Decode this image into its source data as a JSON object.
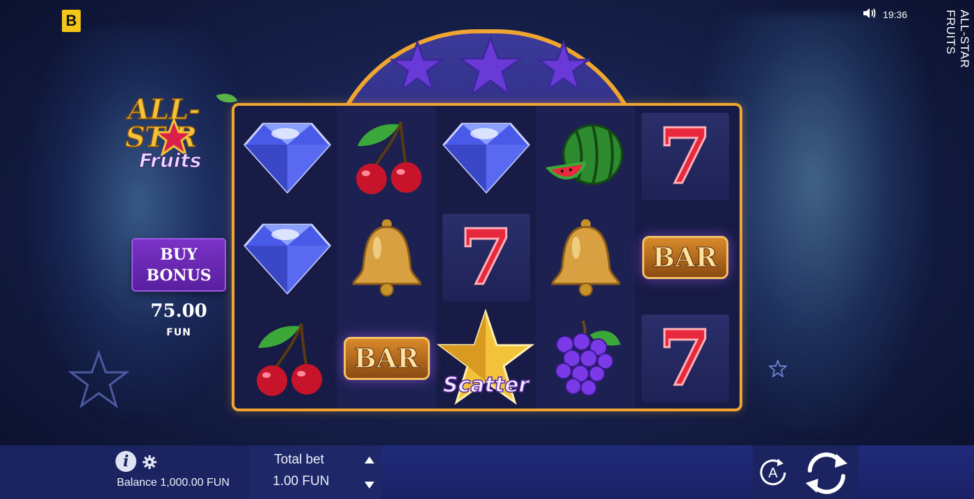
{
  "app": {
    "brand_logo_letter": "B",
    "time": "19:36",
    "side_title": "ALL-STAR FRUITS"
  },
  "game_logo": {
    "line1": "ALL-",
    "line2": "ST  R",
    "line3": "Fruits"
  },
  "buy_bonus": {
    "label_line1": "BUY",
    "label_line2": "BONUS",
    "price": "75.00",
    "currency": "FUN"
  },
  "reels": [
    [
      "diamond",
      "diamond",
      "cherry"
    ],
    [
      "cherry",
      "bell",
      "bar"
    ],
    [
      "diamond",
      "seven",
      "scatter"
    ],
    [
      "watermelon",
      "bell",
      "grapes"
    ],
    [
      "seven",
      "bar",
      "seven"
    ]
  ],
  "symbols": {
    "seven_text": "7",
    "bar_text": "BAR",
    "scatter_text": "Scatter"
  },
  "bottom_bar": {
    "balance": "Balance 1,000.00 FUN",
    "total_bet_label": "Total bet",
    "total_bet_value": "1.00 FUN",
    "info_glyph": "i",
    "auto_glyph": "A"
  },
  "colors": {
    "frame_gold": "#f0a530",
    "bonus_purple": "#7a32c6",
    "brand_yellow": "#f5c518"
  }
}
